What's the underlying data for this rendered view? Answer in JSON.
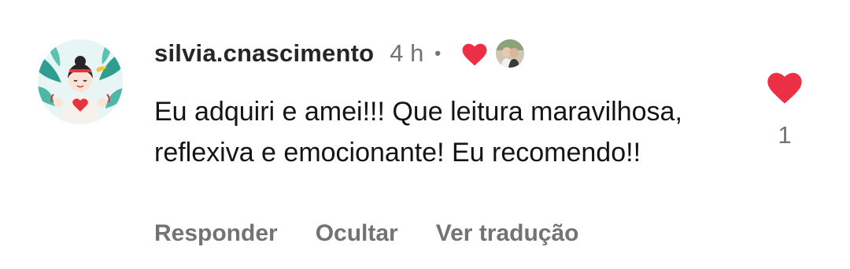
{
  "comment": {
    "username": "silvia.cnascimento",
    "time": "4 h",
    "separator": "•",
    "author_liked_icon": "heart-icon",
    "creator_avatar_icon": "creator-avatar",
    "text": "Eu adquiri e amei!!! Que leitura maravilhosa, reflexiva e emocionante! Eu recomendo!!",
    "like_count": "1",
    "like_icon": "heart-icon",
    "actions": {
      "reply": "Responder",
      "hide": "Ocultar",
      "translate": "Ver tradução"
    }
  },
  "colors": {
    "heart": "#ed2f45",
    "username": "#262626",
    "secondary": "#737373",
    "text": "#141414"
  }
}
